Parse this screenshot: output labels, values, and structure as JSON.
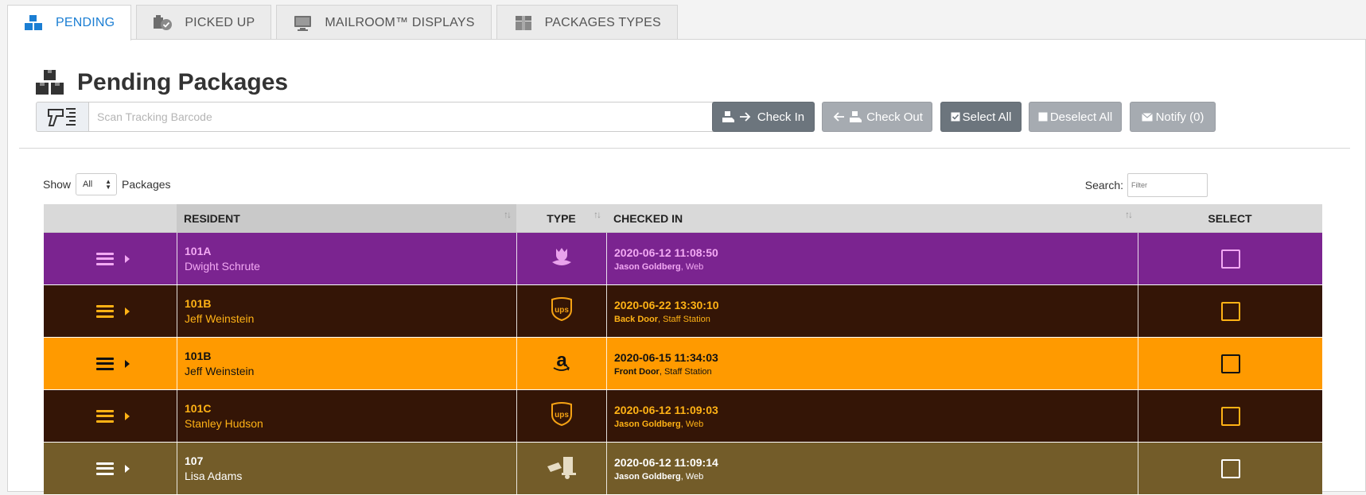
{
  "tabs": [
    {
      "label": "PENDING",
      "icon": "packages-icon",
      "active": true
    },
    {
      "label": "PICKED UP",
      "icon": "picked-up-icon",
      "active": false
    },
    {
      "label": "MAILROOM™ DISPLAYS",
      "icon": "monitor-icon",
      "active": false
    },
    {
      "label": "PACKAGES TYPES",
      "icon": "box-icon",
      "active": false
    }
  ],
  "page": {
    "title": "Pending Packages"
  },
  "scan": {
    "placeholder": "Scan Tracking Barcode",
    "icon": "barcode-scanner-icon"
  },
  "toolbar": {
    "check_in": "Check In",
    "check_out": "Check Out",
    "select_all": "Select All",
    "deselect_all": "Deselect All",
    "notify": "Notify (0)"
  },
  "filter": {
    "show_label": "Show",
    "show_value": "All",
    "packages_label": "Packages",
    "search_label": "Search:",
    "search_placeholder": "Filter"
  },
  "table": {
    "headers": {
      "resident": "RESIDENT",
      "type": "TYPE",
      "checked_in": "CHECKED IN",
      "select": "SELECT"
    },
    "rows": [
      {
        "unit": "101A",
        "name": "Dwight Schrute",
        "type_icon": "flower-icon",
        "time": "2020-06-12 11:08:50",
        "by": "Jason Goldberg",
        "via": ", Web",
        "bg": "#7b2490",
        "fg": "#f2a9f3",
        "icon_color": "#e9a2ec"
      },
      {
        "unit": "101B",
        "name": "Jeff Weinstein",
        "type_icon": "ups-icon",
        "time": "2020-06-22 13:30:10",
        "by": "Back Door",
        "via": ", Staff Station",
        "bg": "#341506",
        "fg": "#ffb215",
        "icon_color": "#f5a214"
      },
      {
        "unit": "101B",
        "name": "Jeff Weinstein",
        "type_icon": "amazon-icon",
        "time": "2020-06-15 11:34:03",
        "by": "Front Door",
        "via": ", Staff Station",
        "bg": "#ff9a00",
        "fg": "#111111",
        "icon_color": "#111111"
      },
      {
        "unit": "101C",
        "name": "Stanley Hudson",
        "type_icon": "ups-icon",
        "time": "2020-06-12 11:09:03",
        "by": "Jason Goldberg",
        "via": ", Web",
        "bg": "#341506",
        "fg": "#ffb215",
        "icon_color": "#f5a214"
      },
      {
        "unit": "107",
        "name": "Lisa Adams",
        "type_icon": "delivery-truck-icon",
        "time": "2020-06-12 11:09:14",
        "by": "Jason Goldberg",
        "via": ", Web",
        "bg": "#735c29",
        "fg": "#ffffff",
        "icon_color": "#e6dcc4"
      }
    ]
  },
  "colors": {
    "accent": "#1b7ed3",
    "btn_dark": "#6c757d",
    "btn_light": "#a6abb1"
  }
}
